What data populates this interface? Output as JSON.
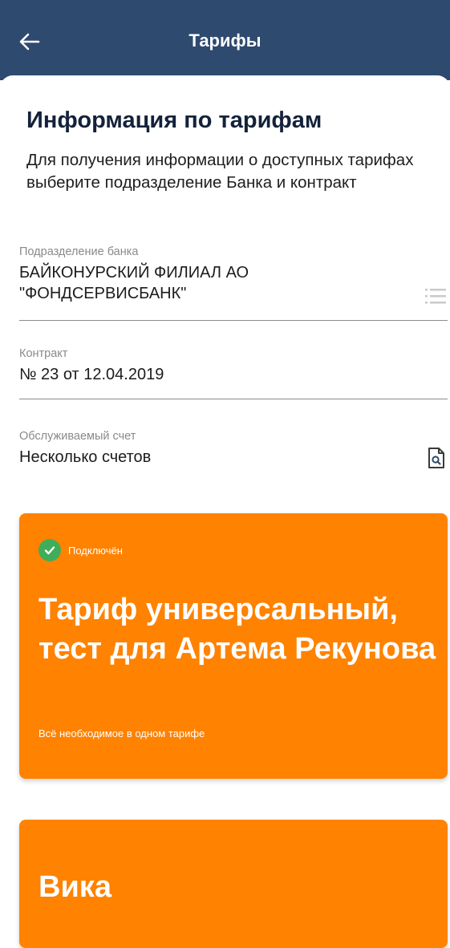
{
  "header": {
    "title": "Тарифы",
    "back_icon": "arrow-left-icon"
  },
  "page": {
    "heading": "Информация по тарифам",
    "intro": "Для получения информации о доступных тарифах выберите подразделение Банка и контракт"
  },
  "fields": {
    "division": {
      "label": "Подразделение банка",
      "value": "БАЙКОНУРСКИЙ ФИЛИАЛ АО \"ФОНДСЕРВИСБАНК\"",
      "icon": "list-icon"
    },
    "contract": {
      "label": "Контракт",
      "value": "№ 23 от 12.04.2019"
    },
    "account": {
      "label": "Обслуживаемый счет",
      "value": "Несколько счетов",
      "icon": "document-search-icon"
    }
  },
  "tariffs": [
    {
      "status": "Подключён",
      "status_icon": "check-circle-icon",
      "status_color": "#3fae5a",
      "title": "Тариф универсальный, тест для Артема Рекунова",
      "subtitle": "Всё необходимое в одном тарифе"
    },
    {
      "title": "Вика"
    }
  ],
  "colors": {
    "header": "#2e4a6f",
    "card": "#ff8200",
    "heading": "#14223a"
  }
}
